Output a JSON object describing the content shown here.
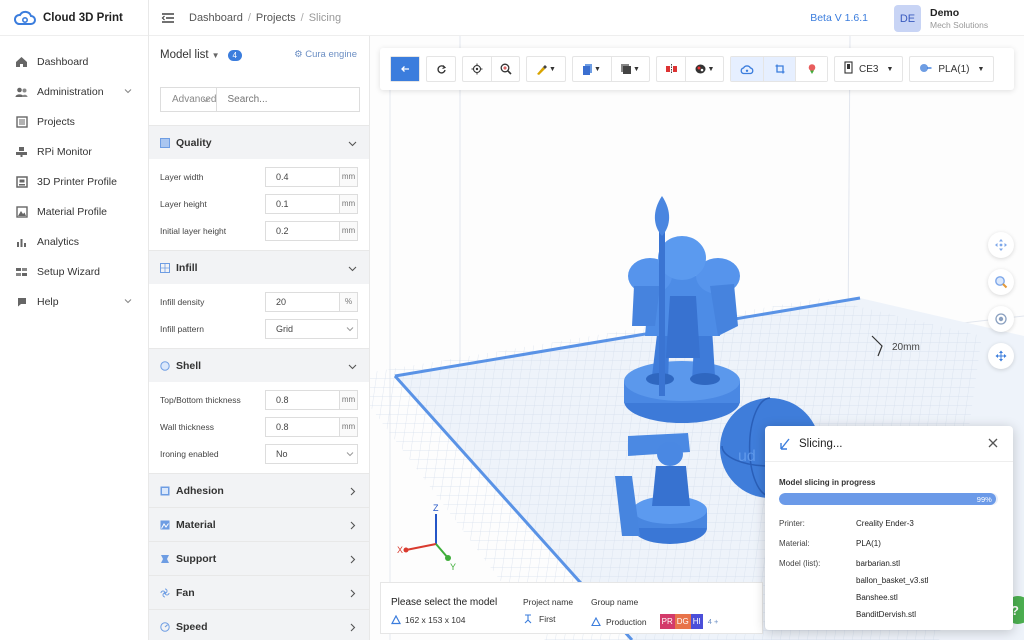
{
  "brand": {
    "name": "Cloud 3D Print"
  },
  "sidebar": {
    "items": [
      {
        "label": "Dashboard",
        "icon": "home-icon",
        "expandable": false
      },
      {
        "label": "Administration",
        "icon": "users-icon",
        "expandable": true
      },
      {
        "label": "Projects",
        "icon": "list-icon",
        "expandable": false
      },
      {
        "label": "RPi Monitor",
        "icon": "monitor-icon",
        "expandable": false
      },
      {
        "label": "3D Printer Profile",
        "icon": "printer-icon",
        "expandable": false
      },
      {
        "label": "Material Profile",
        "icon": "image-icon",
        "expandable": false
      },
      {
        "label": "Analytics",
        "icon": "bar-chart-icon",
        "expandable": false
      },
      {
        "label": "Setup Wizard",
        "icon": "wizard-icon",
        "expandable": false
      },
      {
        "label": "Help",
        "icon": "help-icon",
        "expandable": true
      }
    ]
  },
  "header": {
    "breadcrumbs": [
      "Dashboard",
      "Projects",
      "Slicing"
    ],
    "version": "Beta V 1.6.1",
    "user": {
      "initials": "DE",
      "name": "Demo",
      "org": "Mech Solutions"
    }
  },
  "panel": {
    "title": "Model list",
    "count": "4",
    "engine": "Cura engine",
    "filter_select": "Advanced",
    "search_placeholder": "Search...",
    "sections": {
      "quality": {
        "title": "Quality",
        "fields": [
          {
            "label": "Layer width",
            "value": "0.4",
            "unit": "mm"
          },
          {
            "label": "Layer height",
            "value": "0.1",
            "unit": "mm"
          },
          {
            "label": "Initial layer height",
            "value": "0.2",
            "unit": "mm"
          }
        ]
      },
      "infill": {
        "title": "Infill",
        "fields": [
          {
            "label": "Infill density",
            "value": "20",
            "unit": "%"
          },
          {
            "label": "Infill pattern",
            "value": "Grid"
          }
        ]
      },
      "shell": {
        "title": "Shell",
        "fields": [
          {
            "label": "Top/Bottom thickness",
            "value": "0.8",
            "unit": "mm"
          },
          {
            "label": "Wall thickness",
            "value": "0.8",
            "unit": "mm"
          },
          {
            "label": "Ironing enabled",
            "value": "No"
          }
        ]
      },
      "collapsed": [
        "Adhesion",
        "Material",
        "Support",
        "Fan",
        "Speed"
      ]
    }
  },
  "toolbar": {
    "printer": "CE3",
    "material": "PLA(1)"
  },
  "viewport": {
    "scale_label": "20mm",
    "axes": {
      "x": "X",
      "y": "Y",
      "z": "Z"
    }
  },
  "infobar": {
    "title": "Please select the model",
    "dims": "162 x 153 x 104",
    "project_label": "Project name",
    "project_value": "First",
    "group_label": "Group name",
    "group_value": "Production",
    "tags": [
      "PR",
      "DG",
      "HI"
    ],
    "more": "4 +"
  },
  "slicing": {
    "title": "Slicing...",
    "progress_label": "Model slicing in progress",
    "progress": 0.99,
    "progress_text": "99%",
    "printer_label": "Printer:",
    "printer_value": "Creality Ender-3",
    "material_label": "Material:",
    "material_value": "PLA(1)",
    "models_label": "Model (list):",
    "models": [
      "barbarian.stl",
      "ballon_basket_v3.stl",
      "Banshee.stl",
      "BanditDervish.stl"
    ]
  },
  "help_fab": "?",
  "colors": {
    "accent": "#3b7ddd",
    "model": "#4a8fe8",
    "grid": "#dde6f2"
  }
}
